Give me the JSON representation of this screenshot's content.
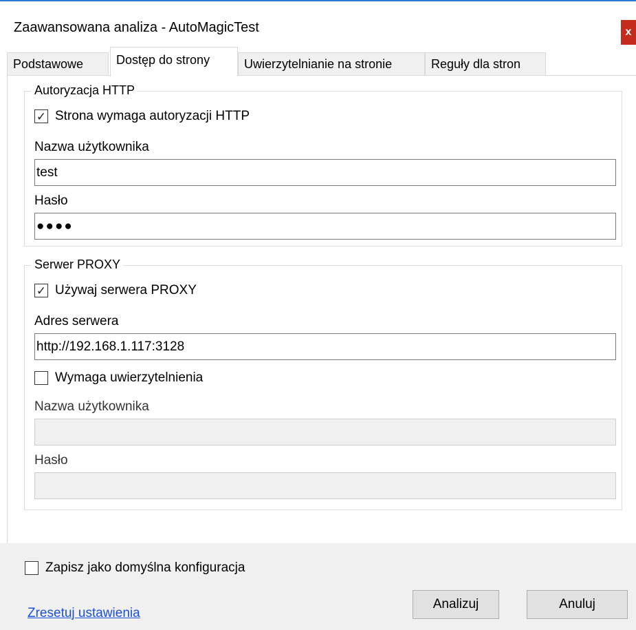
{
  "window": {
    "title": "Zaawansowana analiza - AutoMagicTest",
    "close_label": "x"
  },
  "tabs": [
    {
      "label": "Podstawowe",
      "active": false
    },
    {
      "label": "Dostęp do strony",
      "active": true
    },
    {
      "label": "Uwierzytelnianie na stronie",
      "active": false
    },
    {
      "label": "Reguły dla stron",
      "active": false
    }
  ],
  "http_auth": {
    "group_title": "Autoryzacja HTTP",
    "requires_auth_label": "Strona wymaga autoryzacji HTTP",
    "requires_auth_checked": true,
    "username_label": "Nazwa użytkownika",
    "username_value": "test",
    "password_label": "Hasło",
    "password_masked": "●●●●"
  },
  "proxy": {
    "group_title": "Serwer PROXY",
    "use_proxy_label": "Używaj serwera PROXY",
    "use_proxy_checked": true,
    "address_label": "Adres serwera",
    "address_value": "http://192.168.1.117:3128",
    "requires_auth_label": "Wymaga uwierzytelnienia",
    "requires_auth_checked": false,
    "username_label": "Nazwa użytkownika",
    "username_value": "",
    "password_label": "Hasło",
    "password_value": ""
  },
  "footer": {
    "save_default_label": "Zapisz jako domyślna konfiguracja",
    "save_default_checked": false,
    "reset_link": "Zresetuj ustawienia",
    "analyze_button": "Analizuj",
    "cancel_button": "Anuluj"
  },
  "colors": {
    "accent": "#2b7bd6",
    "close": "#c42b1c",
    "link": "#1a4fd6"
  }
}
